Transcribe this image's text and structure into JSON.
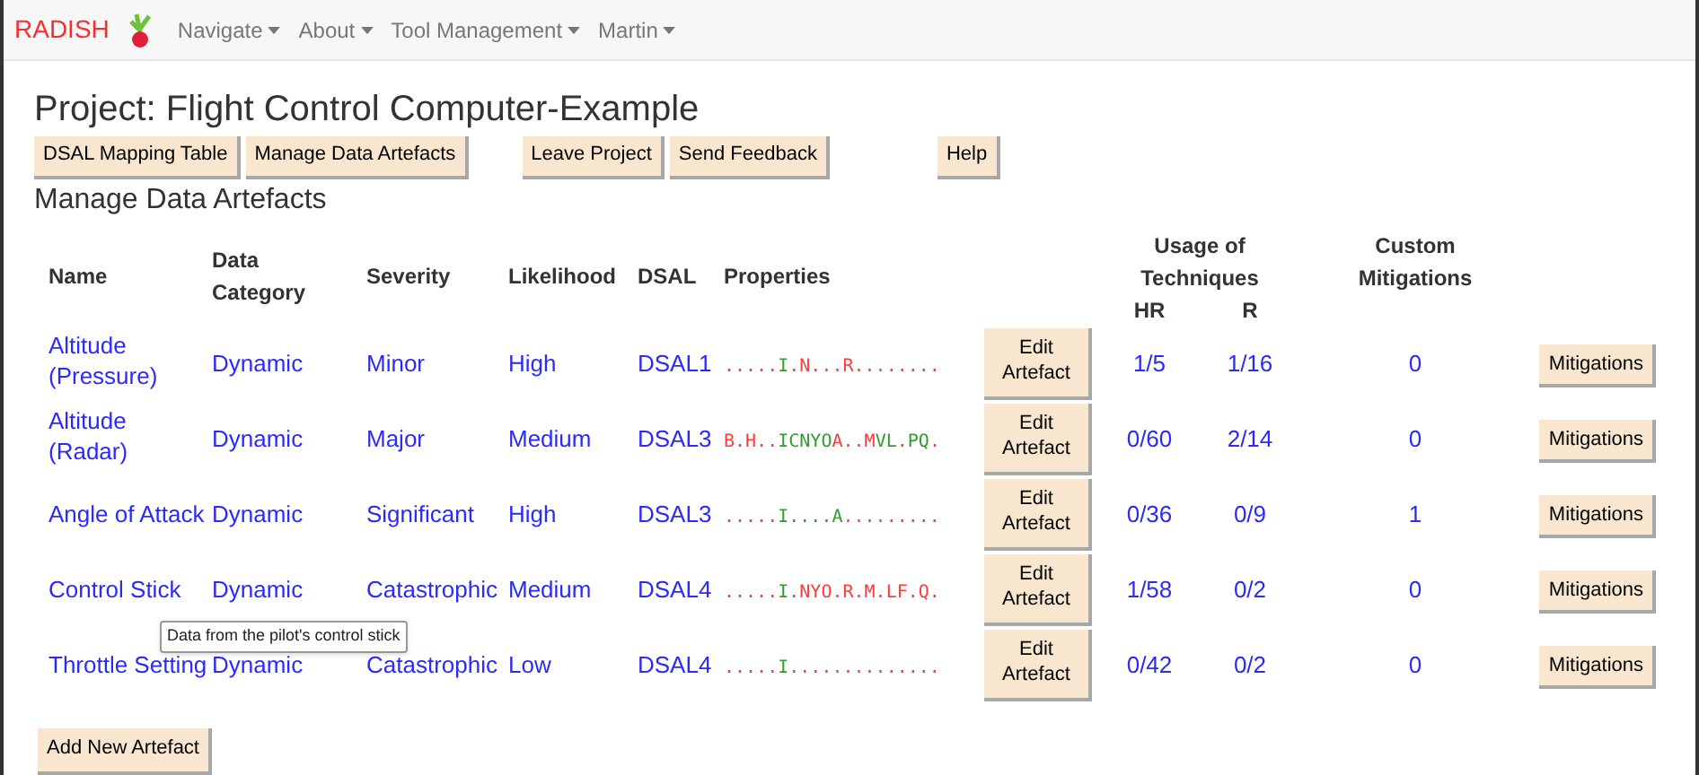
{
  "navbar": {
    "brand": "RADISH",
    "menus": [
      "Navigate",
      "About",
      "Tool Management",
      "Martin"
    ]
  },
  "title": "Project: Flight Control Computer-Example",
  "toolbar": [
    "DSAL Mapping Table",
    "Manage Data Artefacts",
    "Leave Project",
    "Send Feedback",
    "Help"
  ],
  "section_title": "Manage Data Artefacts",
  "table": {
    "columns": [
      "Name",
      "Data Category",
      "Severity",
      "Likelihood",
      "DSAL",
      "Properties",
      "Usage of Techniques",
      "Custom Mitigations"
    ],
    "subcolumns": [
      "HR",
      "R"
    ],
    "rows": [
      {
        "name": "Altitude (Pressure)",
        "category": "Dynamic",
        "severity": "Minor",
        "likelihood": "High",
        "dsal": "DSAL1",
        "properties": [
          {
            "text": ".....",
            "color": "#ff3b3b"
          },
          {
            "text": "I",
            "color": "#2e9e2e"
          },
          {
            "text": ".N...R........",
            "color": "#ff3b3b"
          }
        ],
        "edit": "Edit Artefact",
        "hr": "1/5",
        "r": "1/16",
        "custom": "0",
        "mitigations": "Mitigations"
      },
      {
        "name": "Altitude (Radar)",
        "category": "Dynamic",
        "severity": "Major",
        "likelihood": "Medium",
        "dsal": "DSAL3",
        "properties": [
          {
            "text": "B.H..",
            "color": "#ff3b3b"
          },
          {
            "text": "ICNYO",
            "color": "#2e9e2e"
          },
          {
            "text": "A..M",
            "color": "#ff3b3b"
          },
          {
            "text": "VL",
            "color": "#2e9e2e"
          },
          {
            "text": ".",
            "color": "#ff3b3b"
          },
          {
            "text": "PQ",
            "color": "#2e9e2e"
          },
          {
            "text": ".",
            "color": "#ff3b3b"
          }
        ],
        "edit": "Edit Artefact",
        "hr": "0/60",
        "r": "2/14",
        "custom": "0",
        "mitigations": "Mitigations"
      },
      {
        "name": "Angle of Attack",
        "category": "Dynamic",
        "severity": "Significant",
        "likelihood": "High",
        "dsal": "DSAL3",
        "properties": [
          {
            "text": ".....",
            "color": "#ff3b3b"
          },
          {
            "text": "I....A",
            "color": "#2e9e2e"
          },
          {
            "text": ".........",
            "color": "#ff3b3b"
          }
        ],
        "edit": "Edit Artefact",
        "hr": "0/36",
        "r": "0/9",
        "custom": "1",
        "mitigations": "Mitigations"
      },
      {
        "name": "Control Stick",
        "category": "Dynamic",
        "severity": "Catastrophic",
        "likelihood": "Medium",
        "dsal": "DSAL4",
        "properties": [
          {
            "text": ".....",
            "color": "#ff3b3b"
          },
          {
            "text": "I",
            "color": "#2e9e2e"
          },
          {
            "text": ".NYO.R.M.LF.Q.",
            "color": "#ff3b3b"
          }
        ],
        "edit": "Edit Artefact",
        "hr": "1/58",
        "r": "0/2",
        "custom": "0",
        "mitigations": "Mitigations"
      },
      {
        "name": "Throttle Setting",
        "category": "Dynamic",
        "severity": "Catastrophic",
        "likelihood": "Low",
        "dsal": "DSAL4",
        "properties": [
          {
            "text": ".....",
            "color": "#ff3b3b"
          },
          {
            "text": "I",
            "color": "#2e9e2e"
          },
          {
            "text": "..............",
            "color": "#ff3b3b"
          }
        ],
        "edit": "Edit Artefact",
        "hr": "0/42",
        "r": "0/2",
        "custom": "0",
        "mitigations": "Mitigations"
      }
    ]
  },
  "tooltip": "Data from the pilot's control stick",
  "add_button": "Add New Artefact"
}
